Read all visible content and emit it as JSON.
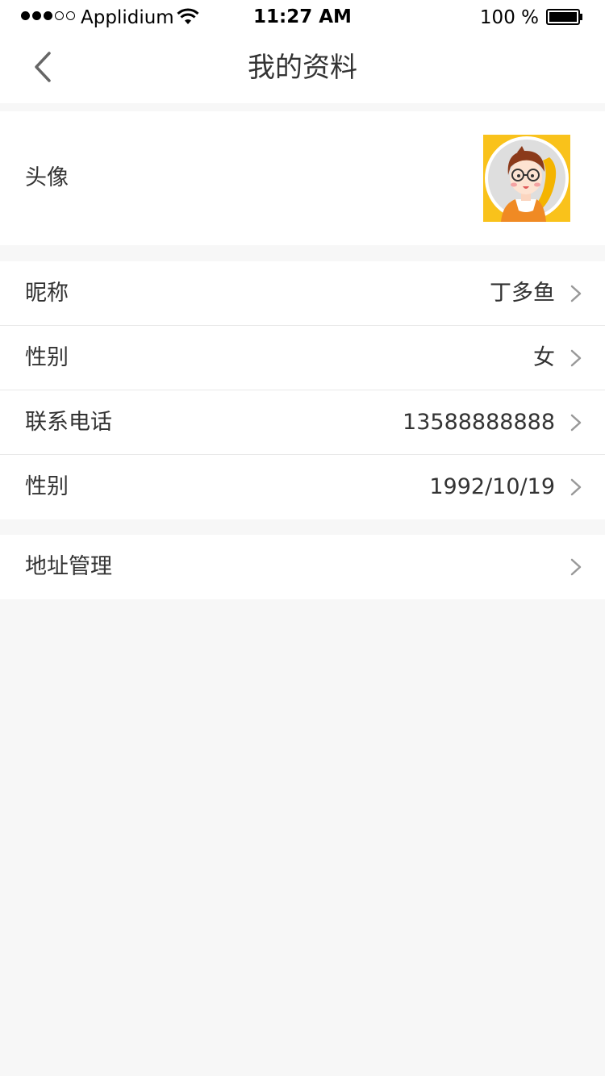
{
  "status_bar": {
    "carrier": "Applidium",
    "time": "11:27 AM",
    "battery": "100 %"
  },
  "nav": {
    "title": "我的资料"
  },
  "avatar_row": {
    "label": "头像"
  },
  "profile_rows": [
    {
      "label": "昵称",
      "value": "丁多鱼"
    },
    {
      "label": "性别",
      "value": "女"
    },
    {
      "label": "联系电话",
      "value": "13588888888"
    },
    {
      "label": "性别",
      "value": "1992/10/19"
    }
  ],
  "address_row": {
    "label": "地址管理"
  },
  "colors": {
    "background": "#f7f7f7",
    "text": "#333333",
    "chevron": "#999999",
    "avatar_accent": "#f9c21b"
  },
  "icons": [
    "back-icon",
    "chevron-right-icon",
    "wifi-icon",
    "battery-icon",
    "avatar-image"
  ]
}
